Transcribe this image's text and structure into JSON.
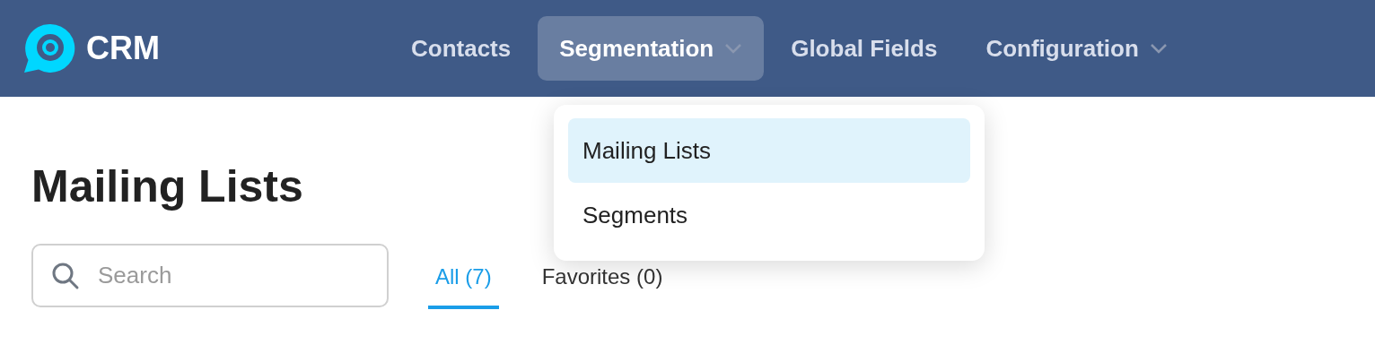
{
  "logo": {
    "text": "CRM"
  },
  "nav": [
    {
      "label": "Contacts",
      "selected": false,
      "dropdown": false
    },
    {
      "label": "Segmentation",
      "selected": true,
      "dropdown": true
    },
    {
      "label": "Global Fields",
      "selected": false,
      "dropdown": false
    },
    {
      "label": "Configuration",
      "selected": false,
      "dropdown": true
    }
  ],
  "menu": [
    {
      "label": "Mailing Lists",
      "selected": true
    },
    {
      "label": "Segments",
      "selected": false
    }
  ],
  "page_title": "Mailing Lists",
  "search": {
    "placeholder": "Search"
  },
  "tabs": [
    {
      "label": "All (7)",
      "selected": true
    },
    {
      "label": "Favorites (0)",
      "selected": false
    }
  ]
}
